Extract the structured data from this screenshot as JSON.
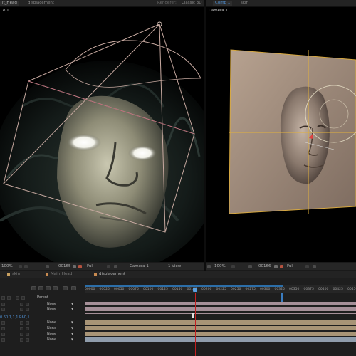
{
  "left_panel": {
    "tabs": [
      "lt_Head",
      "displacement"
    ],
    "renderer_label": "Renderer:",
    "renderer_value": "Classic 3D",
    "viewer_label": "e 1",
    "toolbar": {
      "zoom": "100%",
      "timecode": "00165",
      "resolution": "Full",
      "camera": "Camera 1",
      "views": "1 View"
    }
  },
  "right_panel": {
    "tabs": [
      "Comp 1",
      "skin"
    ],
    "viewer_label": "Camera 1",
    "toolbar": {
      "zoom": "100%",
      "timecode": "00166",
      "resolution": "Full"
    }
  },
  "timeline": {
    "tabs": [
      {
        "label": "skin",
        "color": "#c8a060"
      },
      {
        "label": "Main_Head",
        "color": "#c88a50"
      },
      {
        "label": "displacement",
        "color": "#c88a50"
      }
    ],
    "column_header": "Parent",
    "ruler": [
      "00000",
      "00025",
      "00050",
      "00075",
      "00100",
      "00125",
      "00150",
      "00175",
      "00200",
      "00225",
      "00250",
      "00275",
      "00300",
      "00325",
      "00350",
      "00375",
      "00400",
      "00425",
      "00450"
    ],
    "layers": [
      {
        "mode": "None"
      },
      {
        "mode": "None"
      },
      {
        "mode": "None"
      },
      {
        "mode": "None"
      },
      {
        "mode": "None"
      },
      {
        "mode": "None"
      }
    ],
    "row_label": "0.60 1,1,1 R60,1",
    "colors": {
      "bar_pink": "#a58f98",
      "bar_tan": "#a89476",
      "bar_blue": "#8f9cab",
      "cti": "#c42020",
      "work_area": "#2c6ea8"
    }
  }
}
